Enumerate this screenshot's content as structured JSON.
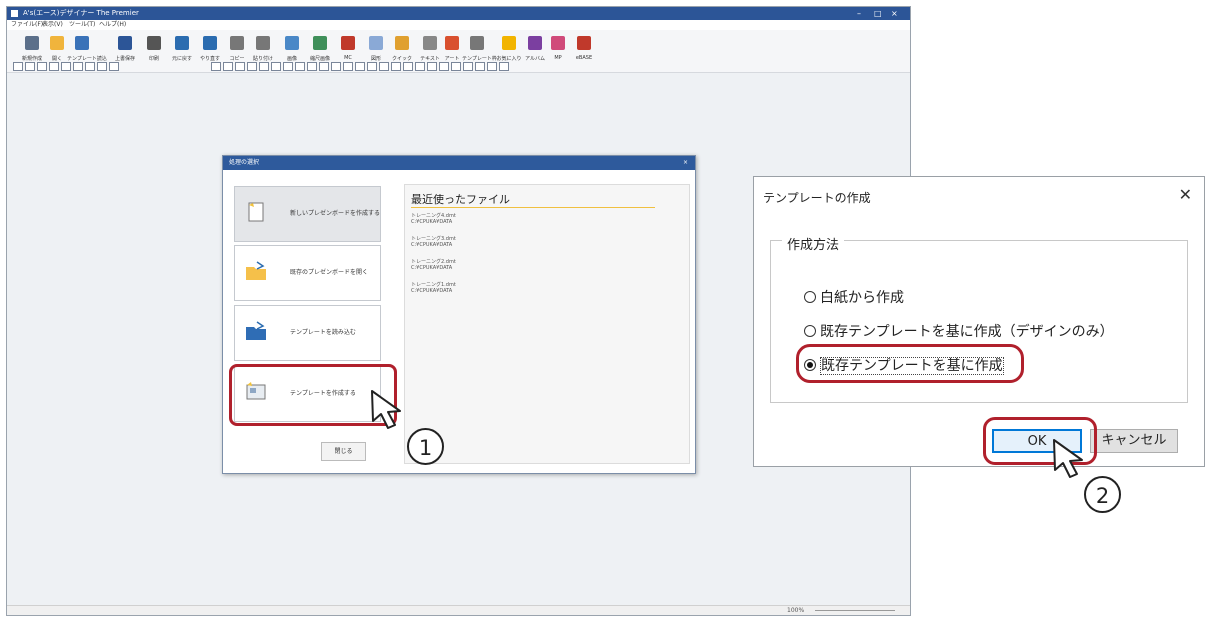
{
  "app": {
    "title": "A's(エース)デザイナー The Premier",
    "menu": [
      "ファイル(F)",
      "表示(V)",
      "ツール(T)",
      "ヘルプ(H)"
    ],
    "toolbar": [
      {
        "label": "新規作成",
        "icon": "new-document-icon"
      },
      {
        "label": "開く",
        "icon": "open-folder-icon"
      },
      {
        "label": "テンプレート読込",
        "icon": "template-load-icon"
      },
      {
        "label": "上書保存",
        "icon": "save-icon"
      },
      {
        "label": "印刷",
        "icon": "print-icon"
      },
      {
        "label": "元に戻す",
        "icon": "undo-icon"
      },
      {
        "label": "やり直す",
        "icon": "redo-icon"
      },
      {
        "label": "コピー",
        "icon": "copy-icon"
      },
      {
        "label": "貼り付け",
        "icon": "paste-icon"
      },
      {
        "label": "画像",
        "icon": "image-icon"
      },
      {
        "label": "縮尺画像",
        "icon": "scaled-image-icon"
      },
      {
        "label": "MC",
        "icon": "mc-icon"
      },
      {
        "label": "図形",
        "icon": "shape-icon"
      },
      {
        "label": "クイック",
        "icon": "quick-icon"
      },
      {
        "label": "テキスト",
        "icon": "text-icon"
      },
      {
        "label": "アート",
        "icon": "art-text-icon"
      },
      {
        "label": "テンプレート枠",
        "icon": "template-frame-icon"
      },
      {
        "label": "お気に入り",
        "icon": "favorite-star-icon"
      },
      {
        "label": "アルバム",
        "icon": "album-icon"
      },
      {
        "label": "MP",
        "icon": "mp-icon"
      },
      {
        "label": "eBASE",
        "icon": "ebase-icon"
      }
    ],
    "status_zoom": "100%"
  },
  "choose_dialog": {
    "title": "処理の選択",
    "options": [
      {
        "label": "新しいプレゼンボードを作成する",
        "icon": "new-board-icon"
      },
      {
        "label": "既存のプレゼンボードを開く",
        "icon": "open-board-icon"
      },
      {
        "label": "テンプレートを読み込む",
        "icon": "load-template-icon"
      },
      {
        "label": "テンプレートを作成する",
        "icon": "create-template-icon"
      }
    ],
    "recent_title": "最近使ったファイル",
    "recent_files": [
      {
        "name": "トレーニング4.dmt",
        "path": "C:¥CPUKA¥DATA"
      },
      {
        "name": "トレーニング3.dmt",
        "path": "C:¥CPUKA¥DATA"
      },
      {
        "name": "トレーニング2.dmt",
        "path": "C:¥CPUKA¥DATA"
      },
      {
        "name": "トレーニング1.dmt",
        "path": "C:¥CPUKA¥DATA"
      }
    ],
    "close_label": "閉じる"
  },
  "template_dialog": {
    "title": "テンプレートの作成",
    "group_label": "作成方法",
    "options": [
      {
        "label": "白紙から作成",
        "selected": false
      },
      {
        "label": "既存テンプレートを基に作成（デザインのみ）",
        "selected": false
      },
      {
        "label": "既存テンプレートを基に作成",
        "selected": true
      }
    ],
    "ok_label": "OK",
    "cancel_label": "キャンセル"
  },
  "callouts": [
    "1",
    "2"
  ],
  "colors": {
    "highlight": "#b0202c",
    "titlebar": "#2c5597",
    "ok_border": "#0078d7"
  }
}
